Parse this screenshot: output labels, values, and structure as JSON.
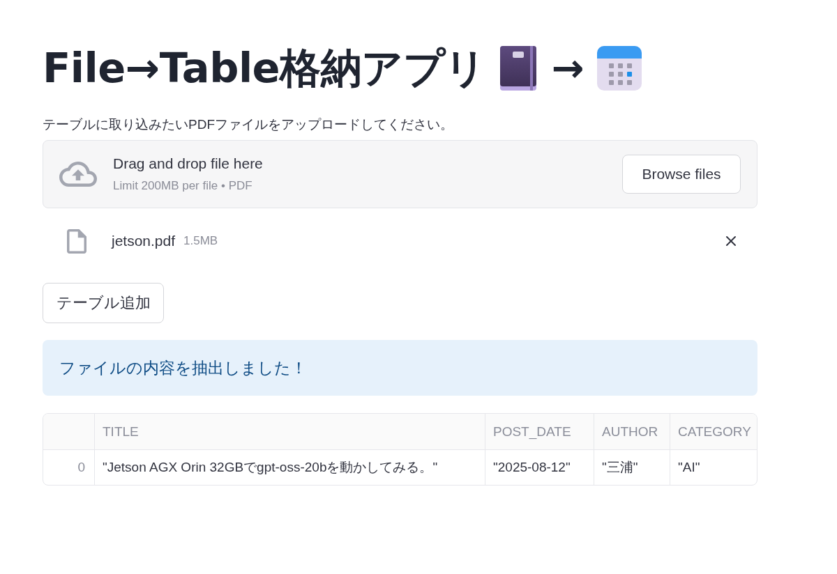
{
  "header": {
    "title": "File→Table格納アプリ",
    "arrow": "→"
  },
  "instruction": "テーブルに取り込みたいPDFファイルをアップロードしてください。",
  "uploader": {
    "heading": "Drag and drop file here",
    "limit": "Limit 200MB per file • PDF",
    "button": "Browse files"
  },
  "files": [
    {
      "name": "jetson.pdf",
      "size": "1.5MB"
    }
  ],
  "add_button": "テーブル追加",
  "alert": {
    "kind": "info",
    "message": "ファイルの内容を抽出しました！"
  },
  "table": {
    "columns": [
      "TITLE",
      "POST_DATE",
      "AUTHOR",
      "CATEGORY"
    ],
    "rows": [
      {
        "index": "0",
        "cells": [
          "\"Jetson AGX Orin 32GBでgpt-oss-20bを動かしてみる。\"",
          "\"2025-08-12\"",
          "\"三浦\"",
          "\"AI\""
        ]
      }
    ]
  }
}
